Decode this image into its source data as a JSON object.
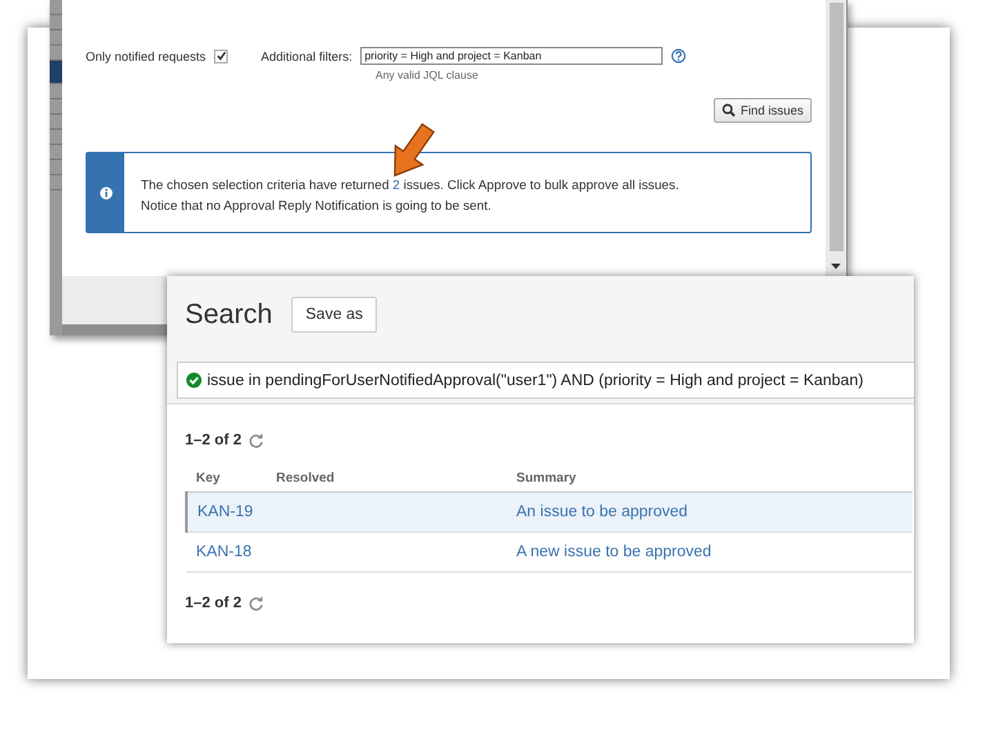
{
  "dialog": {
    "notified_label": "Only notified requests",
    "notified_checked": true,
    "filters_label": "Additional filters:",
    "filters_value": "priority = High and project = Kanban",
    "filters_hint": "Any valid JQL clause",
    "find_button": "Find issues",
    "message": {
      "before": "The chosen selection criteria have returned",
      "count": "2",
      "after": "issues. Click Approve to bulk approve all issues.",
      "line2": "Notice that no Approval Reply Notification is going to be sent."
    }
  },
  "search": {
    "title": "Search",
    "save_button": "Save as",
    "query": "issue in pendingForUserNotifiedApproval(\"user1\") AND (priority = High and project = Kanban)",
    "count_top": "1–2 of 2",
    "columns": [
      "Key",
      "Resolved",
      "Summary"
    ],
    "rows": [
      {
        "key": "KAN-19",
        "summary": "An issue to be approved",
        "selected": true
      },
      {
        "key": "KAN-18",
        "summary": "A new issue to be approved",
        "selected": false
      }
    ],
    "count_bottom": "1–2 of 2"
  }
}
